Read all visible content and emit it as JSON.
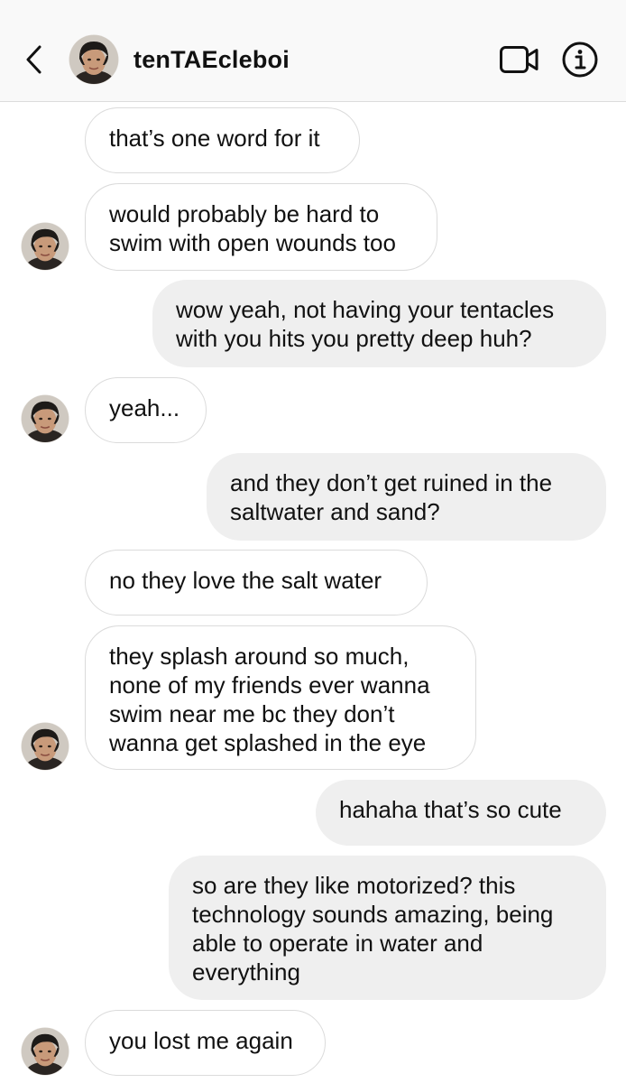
{
  "header": {
    "username": "tenTAEcleboi",
    "back_icon": "chevron-left-icon",
    "video_icon": "video-camera-icon",
    "info_icon": "info-icon"
  },
  "colors": {
    "header_bg": "#f9f9f9",
    "incoming_bubble_bg": "#ffffff",
    "incoming_bubble_border": "#dbdbdb",
    "outgoing_bubble_bg": "#efefef"
  },
  "messages": [
    {
      "side": "in",
      "text": "that’s one word for it"
    },
    {
      "side": "in",
      "text": "would probably be hard to\nswim with open wounds too"
    },
    {
      "side": "out",
      "text": "wow yeah, not having your tentacles\nwith you hits you pretty deep huh?"
    },
    {
      "side": "in",
      "text": "yeah..."
    },
    {
      "side": "out",
      "text": "and they don’t get ruined in the\nsaltwater and sand?"
    },
    {
      "side": "in",
      "text": "no they love the salt water"
    },
    {
      "side": "in",
      "text": "they splash around so much,\nnone of my friends ever wanna\nswim near me bc they don’t\nwanna get splashed in the eye"
    },
    {
      "side": "out",
      "text": "hahaha that’s so cute"
    },
    {
      "side": "out",
      "text": "so are they like motorized? this\ntechnology sounds amazing, being\nable to operate in water and\neverything"
    },
    {
      "side": "in",
      "text": "you lost me again"
    }
  ]
}
